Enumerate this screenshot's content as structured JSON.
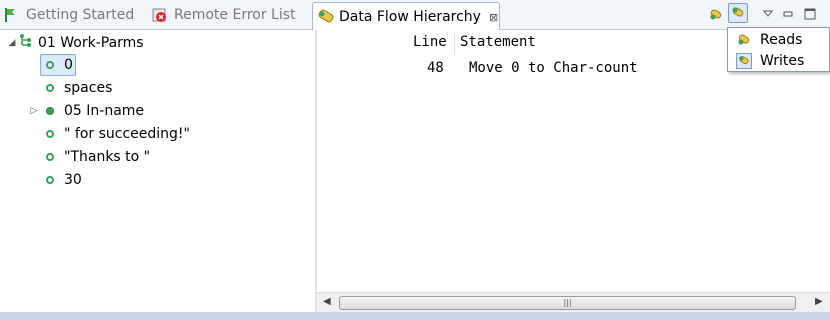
{
  "tabs": [
    {
      "label": "Getting Started",
      "icon": "flag-icon"
    },
    {
      "label": "Remote Error List",
      "icon": "error-list-icon"
    },
    {
      "label": "Data Flow Hierarchy",
      "icon": "data-flow-icon",
      "close": "⊠"
    }
  ],
  "tree": {
    "root": "01 Work-Parms",
    "children": [
      {
        "label": "0"
      },
      {
        "label": "spaces"
      },
      {
        "label": "05 In-name"
      },
      {
        "label": "\" for succeeding!\""
      },
      {
        "label": "\"Thanks to \""
      },
      {
        "label": "30"
      }
    ]
  },
  "table": {
    "headers": [
      "Line",
      "Statement"
    ],
    "rows": [
      {
        "line": "48",
        "statement": "Move 0 to Char-count"
      }
    ]
  },
  "menu": {
    "items": [
      {
        "label": "Reads",
        "icon": "reads-icon"
      },
      {
        "label": "Writes",
        "icon": "writes-icon"
      }
    ]
  },
  "scrollbar": {
    "left": "◀",
    "right": "▶",
    "grip": "|||"
  },
  "colors": {
    "accent": "#3aa15a",
    "selection": "#dbe9fb"
  }
}
